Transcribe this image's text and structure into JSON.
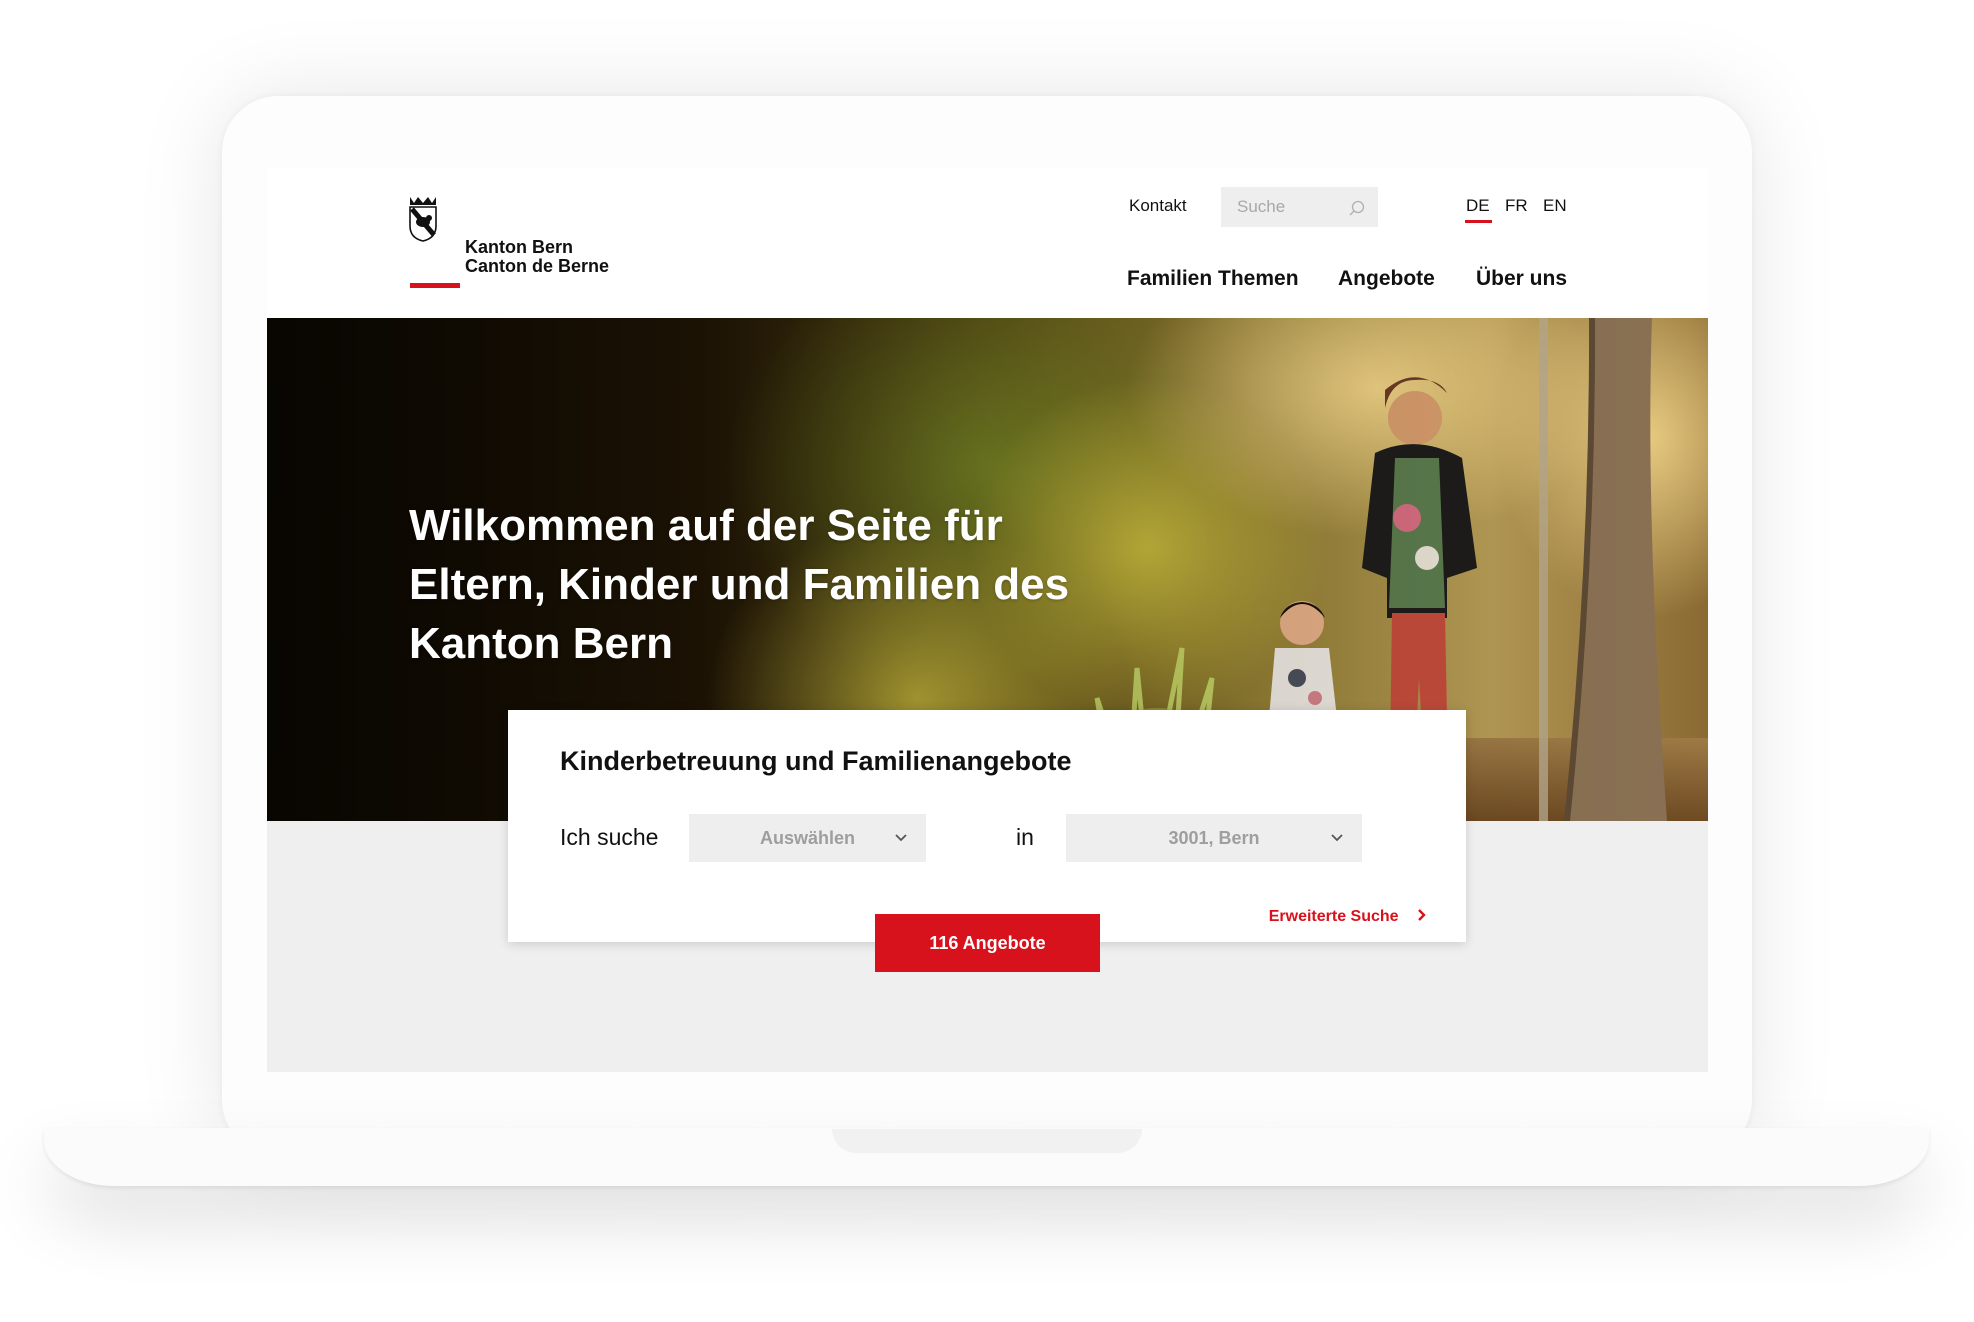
{
  "logo": {
    "line1": "Kanton Bern",
    "line2": "Canton de Berne"
  },
  "topbar": {
    "contact": "Kontakt",
    "search_placeholder": "Suche",
    "languages": [
      "DE",
      "FR",
      "EN"
    ],
    "active_language": "DE"
  },
  "nav": {
    "items": [
      "Familien Themen",
      "Angebote",
      "Über uns"
    ]
  },
  "hero": {
    "title": "Wilkommen auf der Seite für Eltern, Kinder und Familien des Kanton Bern"
  },
  "search_card": {
    "title": "Kinderbetreuung und Familienangebote",
    "label_search": "Ich suche",
    "select_category": "Auswählen",
    "label_in": "in",
    "select_location": "3001, Bern",
    "advanced_link": "Erweiterte Suche",
    "results_button": "116 Angebote"
  },
  "colors": {
    "accent": "#d8121c",
    "field_bg": "#eeeeee",
    "page_bg": "#efefef"
  },
  "icons": {
    "search": "search-icon",
    "select": "chevron-down-icon",
    "link": "chevron-right-icon",
    "coat_of_arms": "bear-coat-of-arms-icon"
  }
}
